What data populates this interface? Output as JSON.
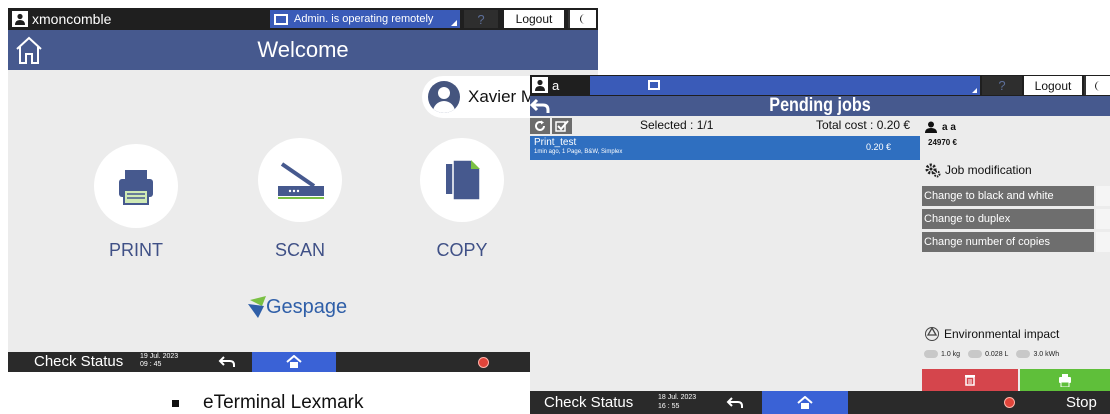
{
  "screen1": {
    "username": "xmoncomble",
    "remote_status": "Admin. is operating remotely",
    "help": "?",
    "logout": "Logout",
    "title": "Welcome",
    "profile_name": "Xavier M",
    "tiles": [
      {
        "label": "PRINT",
        "icon": "printer-icon"
      },
      {
        "label": "SCAN",
        "icon": "scanner-icon"
      },
      {
        "label": "COPY",
        "icon": "copy-icon"
      }
    ],
    "brand": "Gespage",
    "bottom": {
      "check_status": "Check Status",
      "date": "19 Jul. 2023",
      "time": "09 : 45"
    }
  },
  "screen2": {
    "username": "a",
    "help": "?",
    "logout": "Logout",
    "title": "Pending jobs",
    "selected": "Selected : 1/1",
    "total_cost": "Total cost : 0.20 €",
    "job": {
      "name": "Print_test",
      "meta": "1min ago, 1 Page, B&W, Simplex",
      "price": "0.20 €"
    },
    "account_user": "a a",
    "balance": "24970 €",
    "job_modification": "Job modification",
    "modifications": [
      "Change to black and white",
      "Change to duplex",
      "Change number of copies"
    ],
    "environmental_impact": "Environmental impact",
    "env_values": [
      "1.0 kg",
      "0.028 L",
      "3.0 kWh"
    ],
    "bottom": {
      "check_status": "Check Status",
      "date": "18 Jul. 2023",
      "time": "16 : 55",
      "stop": "Stop"
    }
  },
  "caption": "eTerminal Lexmark",
  "colors": {
    "header": "#46598e",
    "accent_blue": "#3a62d6",
    "job_row": "#2f6fc0",
    "delete": "#d5454c",
    "print": "#5fbf3a",
    "label": "#3f5086"
  }
}
